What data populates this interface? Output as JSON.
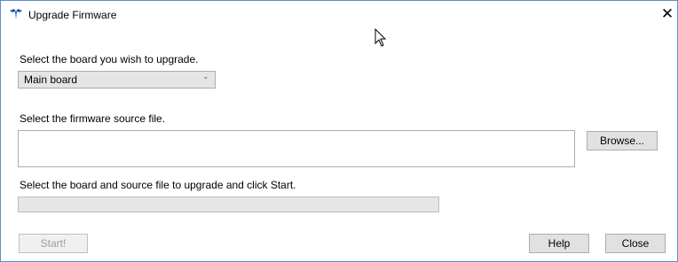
{
  "window": {
    "title": "Upgrade Firmware",
    "close_glyph": "✕",
    "app_icon": "teledyne-logo-icon",
    "accent_color": "#1f5fa5"
  },
  "board": {
    "label": "Select the board you wish to upgrade.",
    "selected": "Main board",
    "chevron": "⌄"
  },
  "source": {
    "label": "Select the firmware source file.",
    "value": "",
    "placeholder": ""
  },
  "buttons": {
    "browse": "Browse...",
    "start": "Start!",
    "help": "Help",
    "close": "Close"
  },
  "status": {
    "message": "Select the board and source file to upgrade and click Start.",
    "progress": 0
  }
}
